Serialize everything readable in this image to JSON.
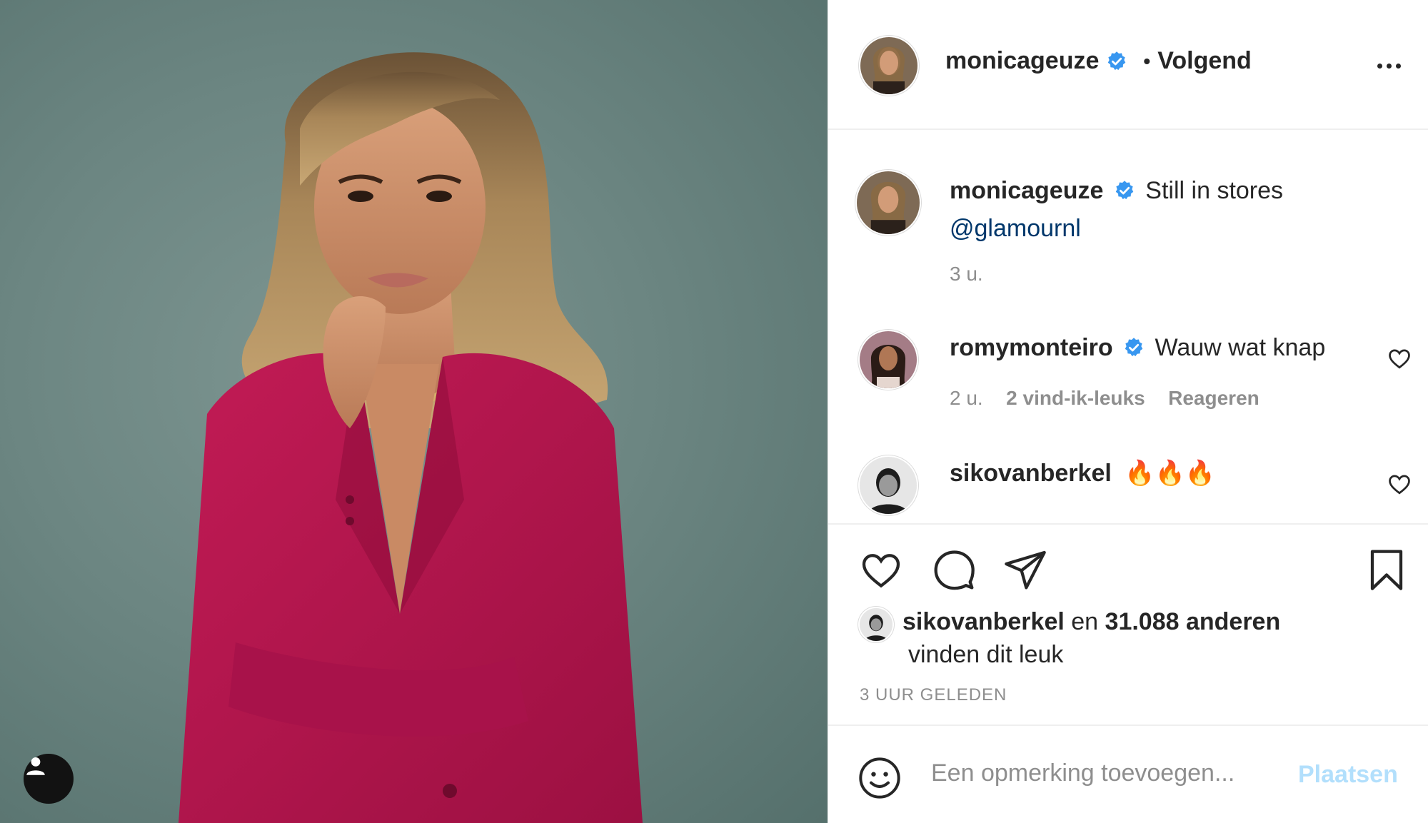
{
  "post": {
    "author": "monicageuze",
    "follow_label": "Volgend",
    "follow_separator": "•",
    "caption_text": "Still in stores",
    "caption_mention": "@glamournl",
    "caption_time": "3 u.",
    "verified_color": "#3897f0"
  },
  "comments": [
    {
      "username": "romymonteiro",
      "verified": true,
      "text": "Wauw wat knap",
      "time": "2 u.",
      "likes": "2 vind-ik-leuks",
      "reply": "Reageren"
    },
    {
      "username": "sikovanberkel",
      "verified": false,
      "text": "🔥🔥🔥"
    }
  ],
  "likes": {
    "user": "sikovanberkel",
    "connector": "en",
    "others": "31.088 anderen",
    "suffix": "vinden dit leuk"
  },
  "timestamp": "3 UUR GELEDEN",
  "composer": {
    "placeholder": "Een opmerking toevoegen...",
    "post_label": "Plaatsen",
    "post_color": "#b2dffc"
  },
  "icons": {
    "like": "heart-icon",
    "comment": "comment-bubble-icon",
    "share": "paper-plane-icon",
    "save": "bookmark-icon",
    "emoji": "smiley-icon",
    "tag": "user-tag-icon",
    "more": "more-dots-icon"
  }
}
